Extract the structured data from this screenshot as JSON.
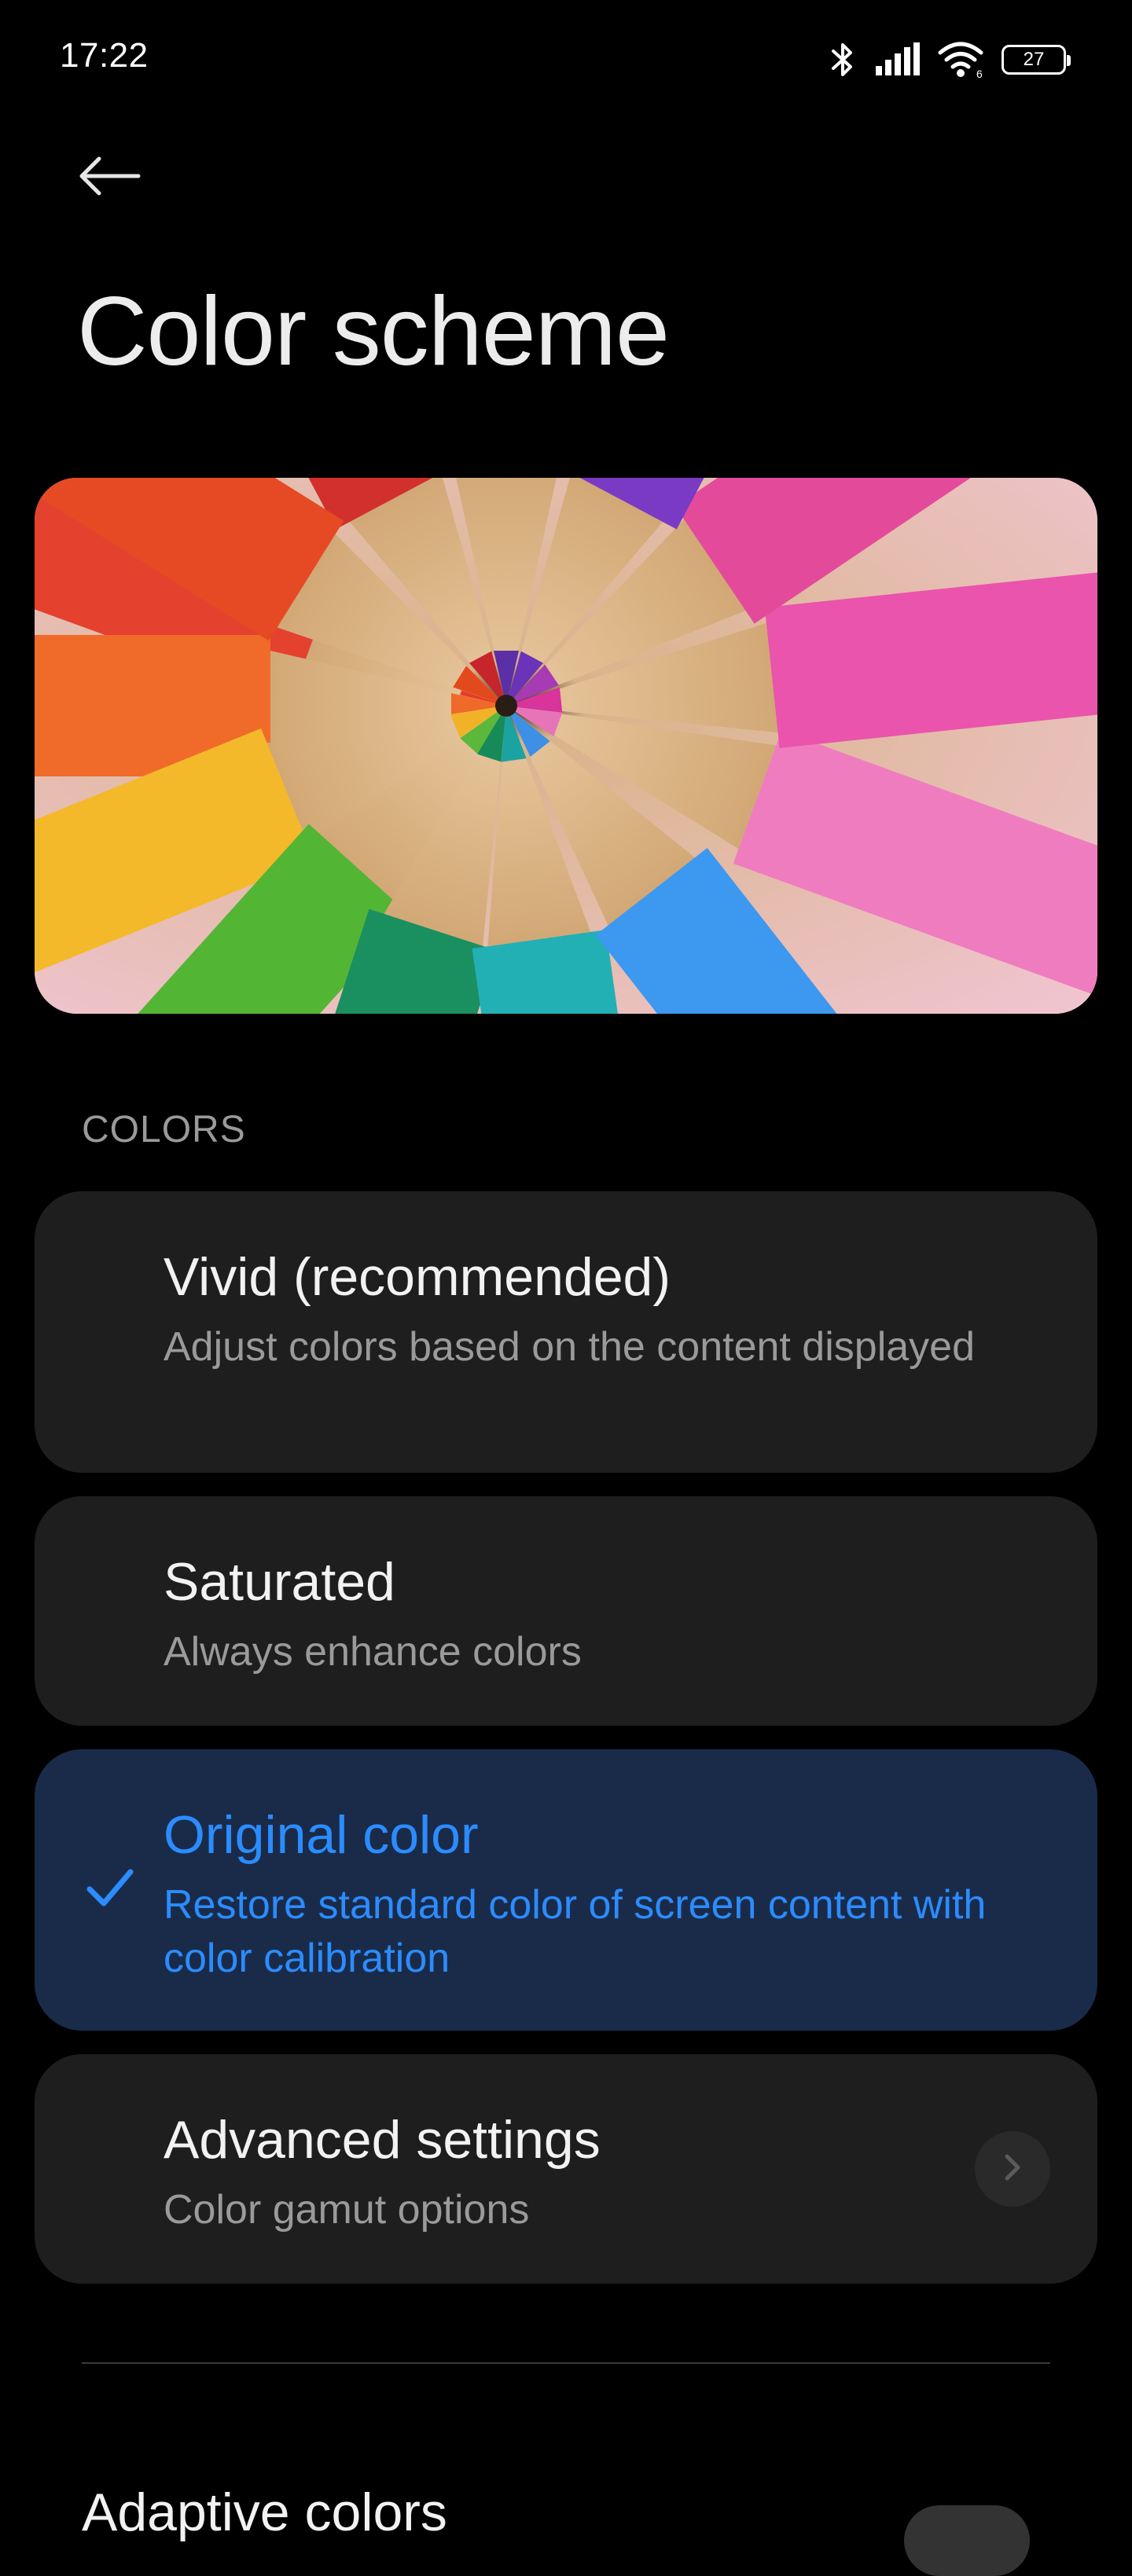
{
  "status_bar": {
    "time": "17:22",
    "battery_level": "27",
    "icons": [
      "bluetooth-icon",
      "signal-icon",
      "wifi-icon",
      "battery-icon"
    ]
  },
  "header": {
    "title": "Color scheme",
    "back_icon": "back-arrow-icon"
  },
  "preview": {
    "image": "colored-pencils-photo"
  },
  "colors_section": {
    "label": "COLORS",
    "options": [
      {
        "title": "Vivid (recommended)",
        "description": "Adjust colors based on the content displayed",
        "selected": false
      },
      {
        "title": "Saturated",
        "description": "Always enhance colors",
        "selected": false
      },
      {
        "title": "Original color",
        "description": "Restore standard color of screen content with color calibration",
        "selected": true
      }
    ],
    "advanced": {
      "title": "Advanced settings",
      "description": "Color gamut options",
      "icon": "chevron-right-icon"
    }
  },
  "adaptive": {
    "title": "Adaptive colors"
  },
  "colors": {
    "background": "#000000",
    "card": "#1e1e1e",
    "selected_card": "#1a2b4a",
    "accent": "#2b8cff",
    "secondary_text": "#9a9a9a"
  }
}
